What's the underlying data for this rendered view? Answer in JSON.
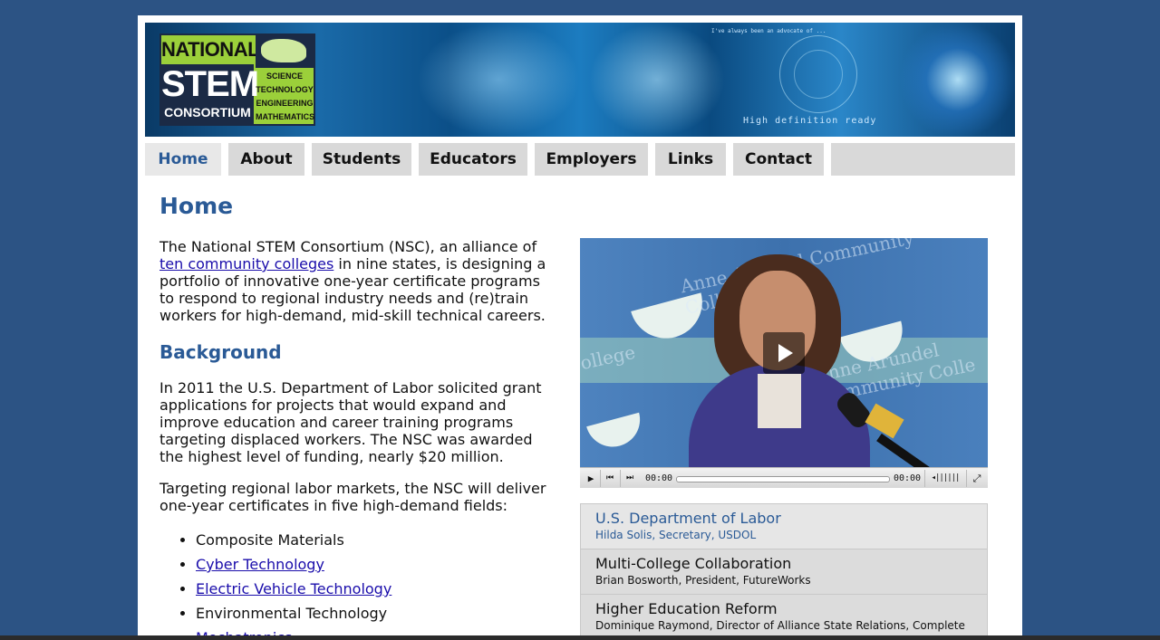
{
  "banner": {
    "logo": {
      "line1": "NATIONAL",
      "line2": "STEM",
      "line3": "CONSORTIUM",
      "fields": [
        "SCIENCE",
        "TECHNOLOGY",
        "ENGINEERING",
        "MATHEMATICS"
      ]
    },
    "overlay_small": "I've always been an advocate of ...",
    "overlay_hd": "High definition ready"
  },
  "nav": {
    "tabs": [
      "Home",
      "About",
      "Students",
      "Educators",
      "Employers",
      "Links",
      "Contact"
    ],
    "active": "Home"
  },
  "main": {
    "title": "Home",
    "intro": {
      "before": "The National STEM Consortium (NSC), an alliance of",
      "link": "ten community colleges",
      "after": "in nine states, is designing a portfolio of innovative one-year certificate programs to respond to regional industry needs and (re)train workers for high-demand, mid-skill technical careers."
    },
    "background_heading": "Background",
    "background_text": "In 2011 the U.S. Department of Labor solicited grant applications for projects that would expand and improve education and career training programs targeting displaced workers. The NSC was awarded the highest level of funding, nearly $20 million.",
    "targeting_text": "Targeting regional labor markets, the NSC will deliver one-year certificates in five high-demand fields:",
    "fields": [
      {
        "label": "Composite Materials",
        "link": false
      },
      {
        "label": "Cyber Technology",
        "link": true
      },
      {
        "label": "Electric Vehicle Technology",
        "link": true
      },
      {
        "label": "Environmental Technology",
        "link": false
      },
      {
        "label": "Mechatronics",
        "link": true
      }
    ]
  },
  "video": {
    "watermark_1": "Anne Arundel Community College",
    "watermark_2": "Anne Arundel Community Colle",
    "watermark_3": "ollege",
    "time_current": "00:00",
    "time_total": "00:00"
  },
  "playlist": [
    {
      "title": "U.S. Department of Labor",
      "subtitle": "Hilda Solis, Secretary, USDOL"
    },
    {
      "title": "Multi-College Collaboration",
      "subtitle": "Brian Bosworth, President, FutureWorks"
    },
    {
      "title": "Higher Education Reform",
      "subtitle": "Dominique Raymond, Director of Alliance State Relations, Complete"
    }
  ]
}
